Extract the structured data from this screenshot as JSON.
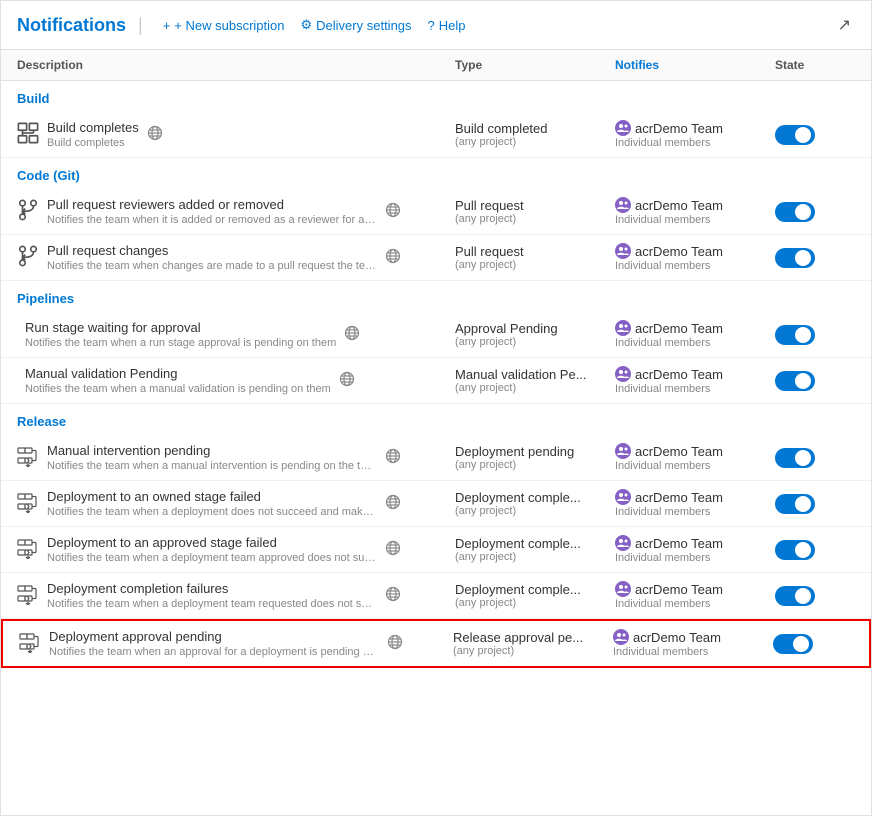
{
  "header": {
    "title": "Notifications",
    "divider": "|",
    "new_subscription": "+ New subscription",
    "delivery_settings": "Delivery settings",
    "help": "Help"
  },
  "table": {
    "columns": [
      "Description",
      "Type",
      "Notifies",
      "State"
    ],
    "sections": [
      {
        "name": "Build",
        "rows": [
          {
            "icon": "build",
            "title": "Build completes",
            "subtitle": "Build completes",
            "has_globe": true,
            "type": "Build completed",
            "type_sub": "(any project)",
            "notifies_name": "acrDemo Team",
            "notifies_sub": "Individual members",
            "state": true
          }
        ]
      },
      {
        "name": "Code (Git)",
        "rows": [
          {
            "icon": "pr",
            "title": "Pull request reviewers added or removed",
            "subtitle": "Notifies the team when it is added or removed as a reviewer for a pull requ...",
            "has_globe": true,
            "type": "Pull request",
            "type_sub": "(any project)",
            "notifies_name": "acrDemo Team",
            "notifies_sub": "Individual members",
            "state": true
          },
          {
            "icon": "pr",
            "title": "Pull request changes",
            "subtitle": "Notifies the team when changes are made to a pull request the team is a r...",
            "has_globe": true,
            "type": "Pull request",
            "type_sub": "(any project)",
            "notifies_name": "acrDemo Team",
            "notifies_sub": "Individual members",
            "state": true
          }
        ]
      },
      {
        "name": "Pipelines",
        "rows": [
          {
            "icon": "none",
            "title": "Run stage waiting for approval",
            "subtitle": "Notifies the team when a run stage approval is pending on them",
            "has_globe": true,
            "type": "Approval Pending",
            "type_sub": "(any project)",
            "notifies_name": "acrDemo Team",
            "notifies_sub": "Individual members",
            "state": true
          },
          {
            "icon": "none",
            "title": "Manual validation Pending",
            "subtitle": "Notifies the team when a manual validation is pending on them",
            "has_globe": true,
            "type": "Manual validation Pe...",
            "type_sub": "(any project)",
            "notifies_name": "acrDemo Team",
            "notifies_sub": "Individual members",
            "state": true
          }
        ]
      },
      {
        "name": "Release",
        "rows": [
          {
            "icon": "release",
            "title": "Manual intervention pending",
            "subtitle": "Notifies the team when a manual intervention is pending on the team",
            "has_globe": true,
            "type": "Deployment pending",
            "type_sub": "(any project)",
            "notifies_name": "acrDemo Team",
            "notifies_sub": "Individual members",
            "state": true
          },
          {
            "icon": "release",
            "title": "Deployment to an owned stage failed",
            "subtitle": "Notifies the team when a deployment does not succeed and makes a stag...",
            "has_globe": true,
            "type": "Deployment comple...",
            "type_sub": "(any project)",
            "notifies_name": "acrDemo Team",
            "notifies_sub": "Individual members",
            "state": true
          },
          {
            "icon": "release",
            "title": "Deployment to an approved stage failed",
            "subtitle": "Notifies the team when a deployment team approved does not succeed an...",
            "has_globe": true,
            "type": "Deployment comple...",
            "type_sub": "(any project)",
            "notifies_name": "acrDemo Team",
            "notifies_sub": "Individual members",
            "state": true
          },
          {
            "icon": "release",
            "title": "Deployment completion failures",
            "subtitle": "Notifies the team when a deployment team requested does not succeed a...",
            "has_globe": true,
            "type": "Deployment comple...",
            "type_sub": "(any project)",
            "notifies_name": "acrDemo Team",
            "notifies_sub": "Individual members",
            "state": true
          },
          {
            "icon": "release",
            "title": "Deployment approval pending",
            "subtitle": "Notifies the team when an approval for a deployment is pending on the te...",
            "has_globe": true,
            "type": "Release approval pe...",
            "type_sub": "(any project)",
            "notifies_name": "acrDemo Team",
            "notifies_sub": "Individual members",
            "state": true,
            "highlighted": true
          }
        ]
      }
    ]
  }
}
